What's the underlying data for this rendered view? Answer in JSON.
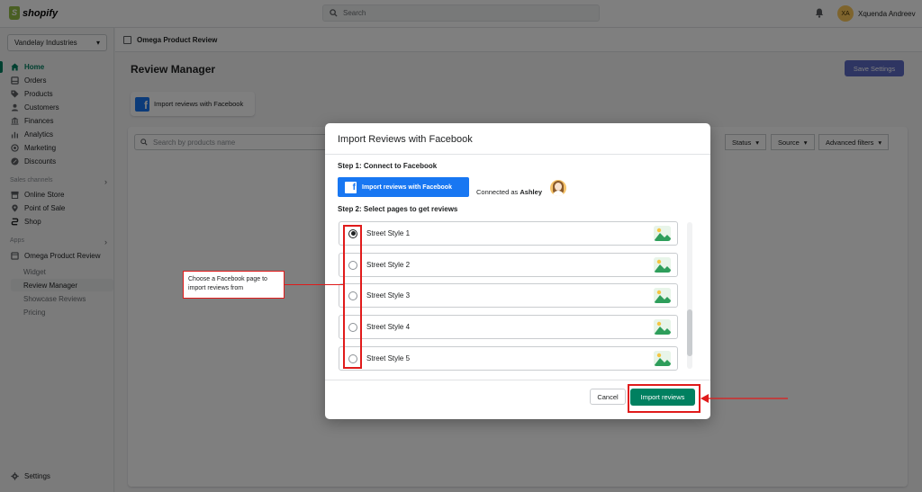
{
  "topbar": {
    "brand": "shopify",
    "search_placeholder": "Search",
    "user_initials": "XA",
    "user_name": "Xquenda Andreev"
  },
  "sidebar": {
    "store_name": "Vandelay Industries",
    "nav": [
      {
        "label": "Home",
        "icon": "home-icon",
        "active": true
      },
      {
        "label": "Orders",
        "icon": "orders-icon"
      },
      {
        "label": "Products",
        "icon": "tag-icon"
      },
      {
        "label": "Customers",
        "icon": "person-icon"
      },
      {
        "label": "Finances",
        "icon": "bank-icon"
      },
      {
        "label": "Analytics",
        "icon": "bar-chart-icon"
      },
      {
        "label": "Marketing",
        "icon": "target-icon"
      },
      {
        "label": "Discounts",
        "icon": "discount-icon"
      }
    ],
    "sales_channels_label": "Sales channels",
    "channels": [
      {
        "label": "Online Store",
        "icon": "store-icon"
      },
      {
        "label": "Point of Sale",
        "icon": "pin-icon"
      },
      {
        "label": "Shop",
        "icon": "shop-icon"
      }
    ],
    "apps_label": "Apps",
    "app_name": "Omega Product Review",
    "app_sub": [
      {
        "label": "Widget"
      },
      {
        "label": "Review Manager",
        "active": true
      },
      {
        "label": "Showcase Reviews"
      },
      {
        "label": "Pricing"
      }
    ],
    "settings_label": "Settings"
  },
  "app_header": {
    "title": "Omega Product Review"
  },
  "page": {
    "title": "Review Manager",
    "save_label": "Save Settings",
    "fb_tab_label": "Import reviews with Facebook",
    "search_placeholder": "Search by products name",
    "filters": [
      "Status",
      "Source",
      "Advanced filters"
    ]
  },
  "modal": {
    "title": "Import Reviews with Facebook",
    "step1": "Step 1: Connect to Facebook",
    "fb_button": "Import reviews with Facebook",
    "connected_prefix": "Connected as",
    "connected_name": "Ashley",
    "step2": "Step 2: Select pages to get reviews",
    "pages": [
      {
        "name": "Street Style 1",
        "selected": true
      },
      {
        "name": "Street Style 2",
        "selected": false
      },
      {
        "name": "Street Style 3",
        "selected": false
      },
      {
        "name": "Street Style 4",
        "selected": false
      },
      {
        "name": "Street Style 5",
        "selected": false
      }
    ],
    "cancel_label": "Cancel",
    "import_label": "Import reviews"
  },
  "annotation": {
    "callout_text": "Choose a Facebook page to import reviews from",
    "color": "#e01b1b"
  },
  "colors": {
    "shopify_green": "#008060",
    "facebook_blue": "#1877f2",
    "save_button": "#5c6ac4"
  }
}
